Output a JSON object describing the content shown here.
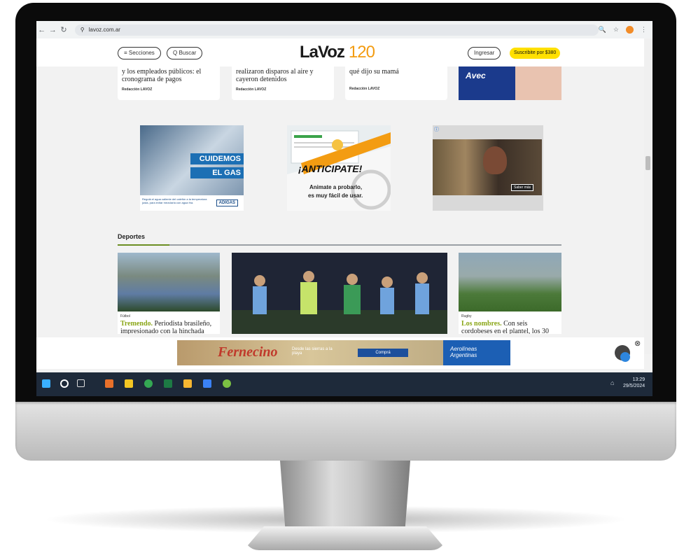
{
  "browser": {
    "url": "lavoz.com.ar",
    "nav": [
      "←",
      "→",
      "↻"
    ],
    "right_icons": [
      "zoom-icon",
      "star-icon",
      "profile-avatar",
      "menu-icon"
    ]
  },
  "header": {
    "sections_label": "≡  Secciones",
    "search_label": "Q  Buscar",
    "logo_text": "LaVoz",
    "logo_number": "120",
    "login_label": "Ingresar",
    "subscribe_label": "Suscribite por $380"
  },
  "top_cards": [
    {
      "text": "y los empleados públicos: el cronograma de pagos",
      "author": "Redacción LAVOZ"
    },
    {
      "text": "realizaron disparos al aire y cayeron detenidos",
      "author": "Redacción LAVOZ"
    },
    {
      "text": "qué dijo su mamá",
      "author": "Redacción LAVOZ"
    }
  ],
  "ads": {
    "top_right_brand": "Avec",
    "gas_line1": "CUIDEMOS",
    "gas_line2": "EL GAS",
    "gas_foot": "Regulá el agua caliente del calefón a la temperatura justa, para evitar mezclarla con agua fría.",
    "gas_brand": "ADIGAS",
    "anticipate_title": "¡ANTICIPATE!",
    "anticipate_sub1": "Animate a probarlo,",
    "anticipate_sub2": "es muy fácil de usar.",
    "video_cta": "Saber más",
    "bottom_brand": "Fernecino",
    "bottom_sub": "Desde las sierras a la playa",
    "bottom_cta": "Comprá",
    "bottom_airline": "Aerolíneas Argentinas"
  },
  "section": {
    "title": "Deportes"
  },
  "sports": [
    {
      "category": "Fútbol",
      "highlight": "Tremendo.",
      "text": "Periodista brasileño, impresionado con la hinchada"
    },
    {
      "category": "",
      "highlight": "",
      "text": ""
    },
    {
      "category": "Rugby",
      "highlight": "Los nombres.",
      "text": "Con seis cordobeses en el plantel, los 30"
    }
  ],
  "taskbar": {
    "time": "13:29",
    "date": "29/5/2024"
  },
  "colors": {
    "accent_green": "#8aa617",
    "subscribe_yellow": "#ffe000",
    "logo_orange": "#f39c12",
    "taskbar": "#1e2a3a"
  }
}
